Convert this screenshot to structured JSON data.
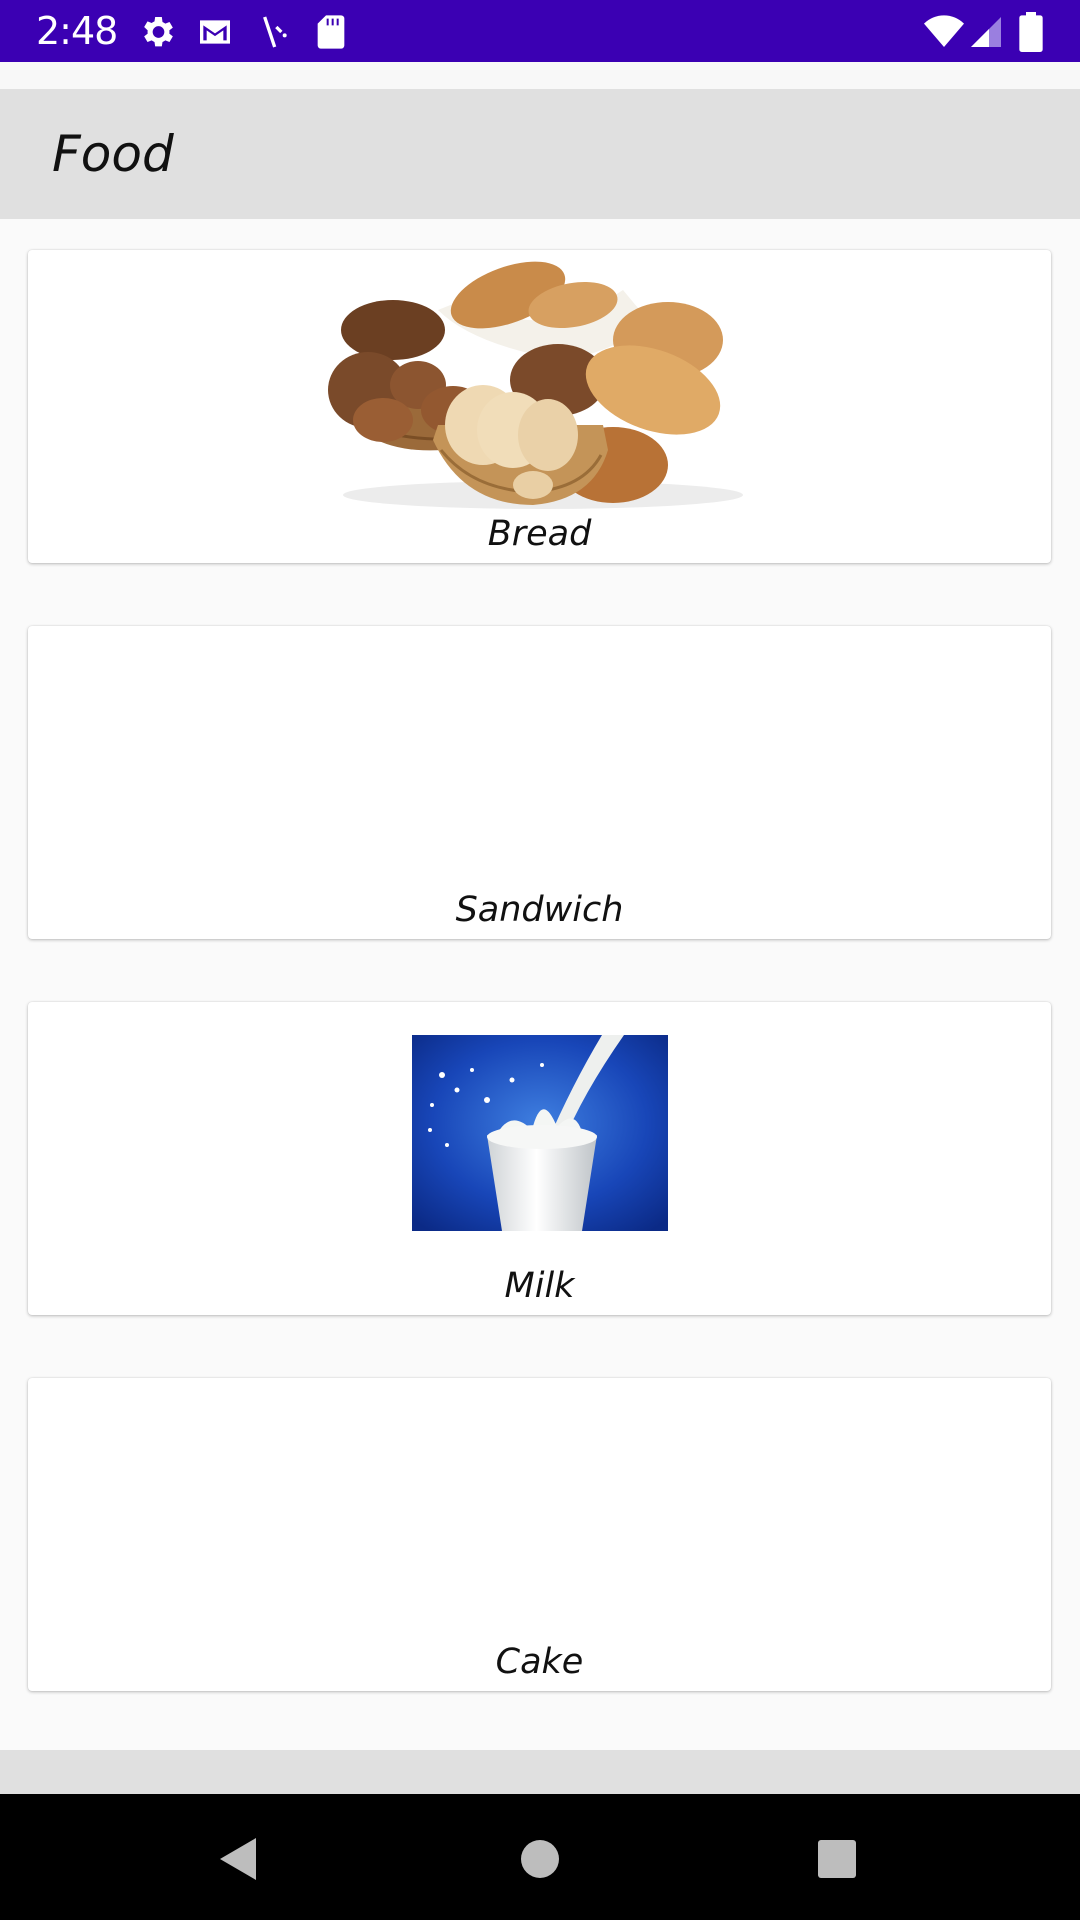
{
  "status_bar": {
    "time": "2:48",
    "left_icons": [
      "settings-icon",
      "gmail-icon",
      "app-icon",
      "sd-card-icon"
    ],
    "right_icons": [
      "wifi-icon",
      "cell-signal-icon",
      "battery-icon"
    ],
    "background": "#3b00b3"
  },
  "app_bar": {
    "title": "Food",
    "background": "#e0e0e0"
  },
  "items": [
    {
      "label": "Bread",
      "image": "bread-image"
    },
    {
      "label": "Sandwich",
      "image": ""
    },
    {
      "label": "Milk",
      "image": "milk-image"
    },
    {
      "label": "Cake",
      "image": ""
    }
  ],
  "nav_bar": {
    "buttons": [
      "back-icon",
      "home-icon",
      "recents-icon"
    ]
  }
}
